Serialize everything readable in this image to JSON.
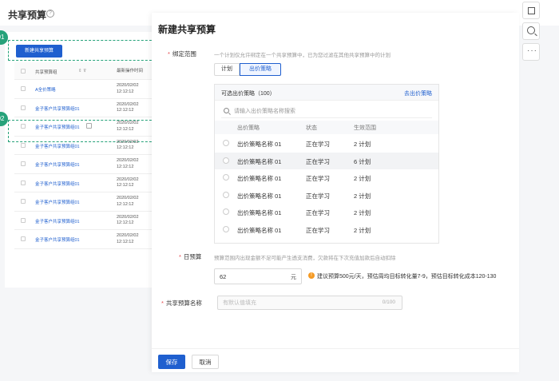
{
  "page": {
    "title": "共享预算",
    "help_icon": "question-circle-icon"
  },
  "steps": [
    "01",
    "02"
  ],
  "list": {
    "new_button": "新建共享预算",
    "header": {
      "name": "共享预算组",
      "sort": "⇕ ⊽",
      "time": "最新操作时间"
    },
    "rows": [
      {
        "name": "A全价策略",
        "date": "2020/02/02",
        "time": "12:12:12"
      },
      {
        "name": "金子客户共享预算组01",
        "date": "2020/02/02",
        "time": "12:12:12"
      },
      {
        "name": "金子客户共享预算组01",
        "date": "2020/02/02",
        "time": "12:12:12"
      },
      {
        "name": "金子客户共享预算组01",
        "date": "2020/02/02",
        "time": "12:12:12"
      },
      {
        "name": "金子客户共享预算组01",
        "date": "2020/02/02",
        "time": "12:12:12"
      },
      {
        "name": "金子客户共享预算组01",
        "date": "2020/02/02",
        "time": "12:12:12"
      },
      {
        "name": "金子客户共享预算组01",
        "date": "2020/02/02",
        "time": "12:12:12"
      },
      {
        "name": "金子客户共享预算组01",
        "date": "2020/02/02",
        "time": "12:12:12"
      },
      {
        "name": "金子客户共享预算组01",
        "date": "2020/02/02",
        "time": "12:12:12"
      }
    ]
  },
  "tools": [
    "frame-icon",
    "zoom-in-icon",
    "more-icon"
  ],
  "drawer": {
    "title": "新建共享预算",
    "bind": {
      "label": "绑定范围",
      "hint": "一个计划仅允许绑定在一个共享预算中，已为您过滤在其他共享预算中的计划",
      "tabs": [
        "计划",
        "出价策略"
      ]
    },
    "panel": {
      "title": "可选出价策略（100）",
      "link": "去出价策略",
      "search_placeholder": "请输入出价策略名称搜索",
      "columns": [
        "出价策略",
        "状态",
        "生效范围"
      ],
      "rows": [
        {
          "name": "出价策略名称 01",
          "status": "正在学习",
          "scope": "2 计划"
        },
        {
          "name": "出价策略名称 01",
          "status": "正在学习",
          "scope": "6 计划"
        },
        {
          "name": "出价策略名称 01",
          "status": "正在学习",
          "scope": "2 计划"
        },
        {
          "name": "出价策略名称 01",
          "status": "正在学习",
          "scope": "2 计划"
        },
        {
          "name": "出价策略名称 01",
          "status": "正在学习",
          "scope": "2 计划"
        },
        {
          "name": "出价策略名称 01",
          "status": "正在学习",
          "scope": "2 计划"
        }
      ]
    },
    "daily": {
      "label": "日预算",
      "hint": "预算范围内出现金额不足可能产生透支消费，欠款将在下次充值加款后自动扣除",
      "value": "62",
      "unit": "元",
      "suggestion": "建议预算500元/天，预估周均目标转化量7-9，预估目标转化成本120-130"
    },
    "name": {
      "label": "共享预算名称",
      "placeholder": "有默认值填充",
      "count": "0/100"
    },
    "footer": {
      "save": "保存",
      "cancel": "取消"
    }
  },
  "colors": {
    "primary": "#1f5fcf",
    "step": "#26a27a",
    "warn": "#f59a23",
    "required": "#e5484d"
  }
}
